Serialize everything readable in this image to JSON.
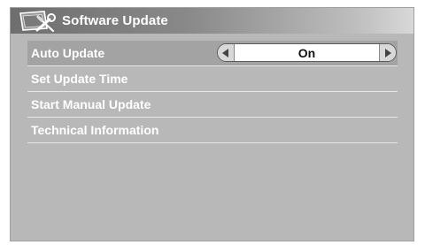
{
  "dialog": {
    "title": "Software Update",
    "title_icon": "wrench-tools-icon"
  },
  "menu": {
    "selected_index": 0,
    "items": [
      {
        "label": "Auto Update",
        "value": "On",
        "left_arrow": "arrow-left-icon",
        "right_arrow": "arrow-right-icon"
      },
      {
        "label": "Set Update Time"
      },
      {
        "label": "Start Manual Update"
      },
      {
        "label": "Technical Information"
      }
    ]
  },
  "colors": {
    "panel_bg": "#b8b8b8",
    "selected_row_bg": "#a3a3a3",
    "text": "#ffffff",
    "value_text": "#111111"
  }
}
